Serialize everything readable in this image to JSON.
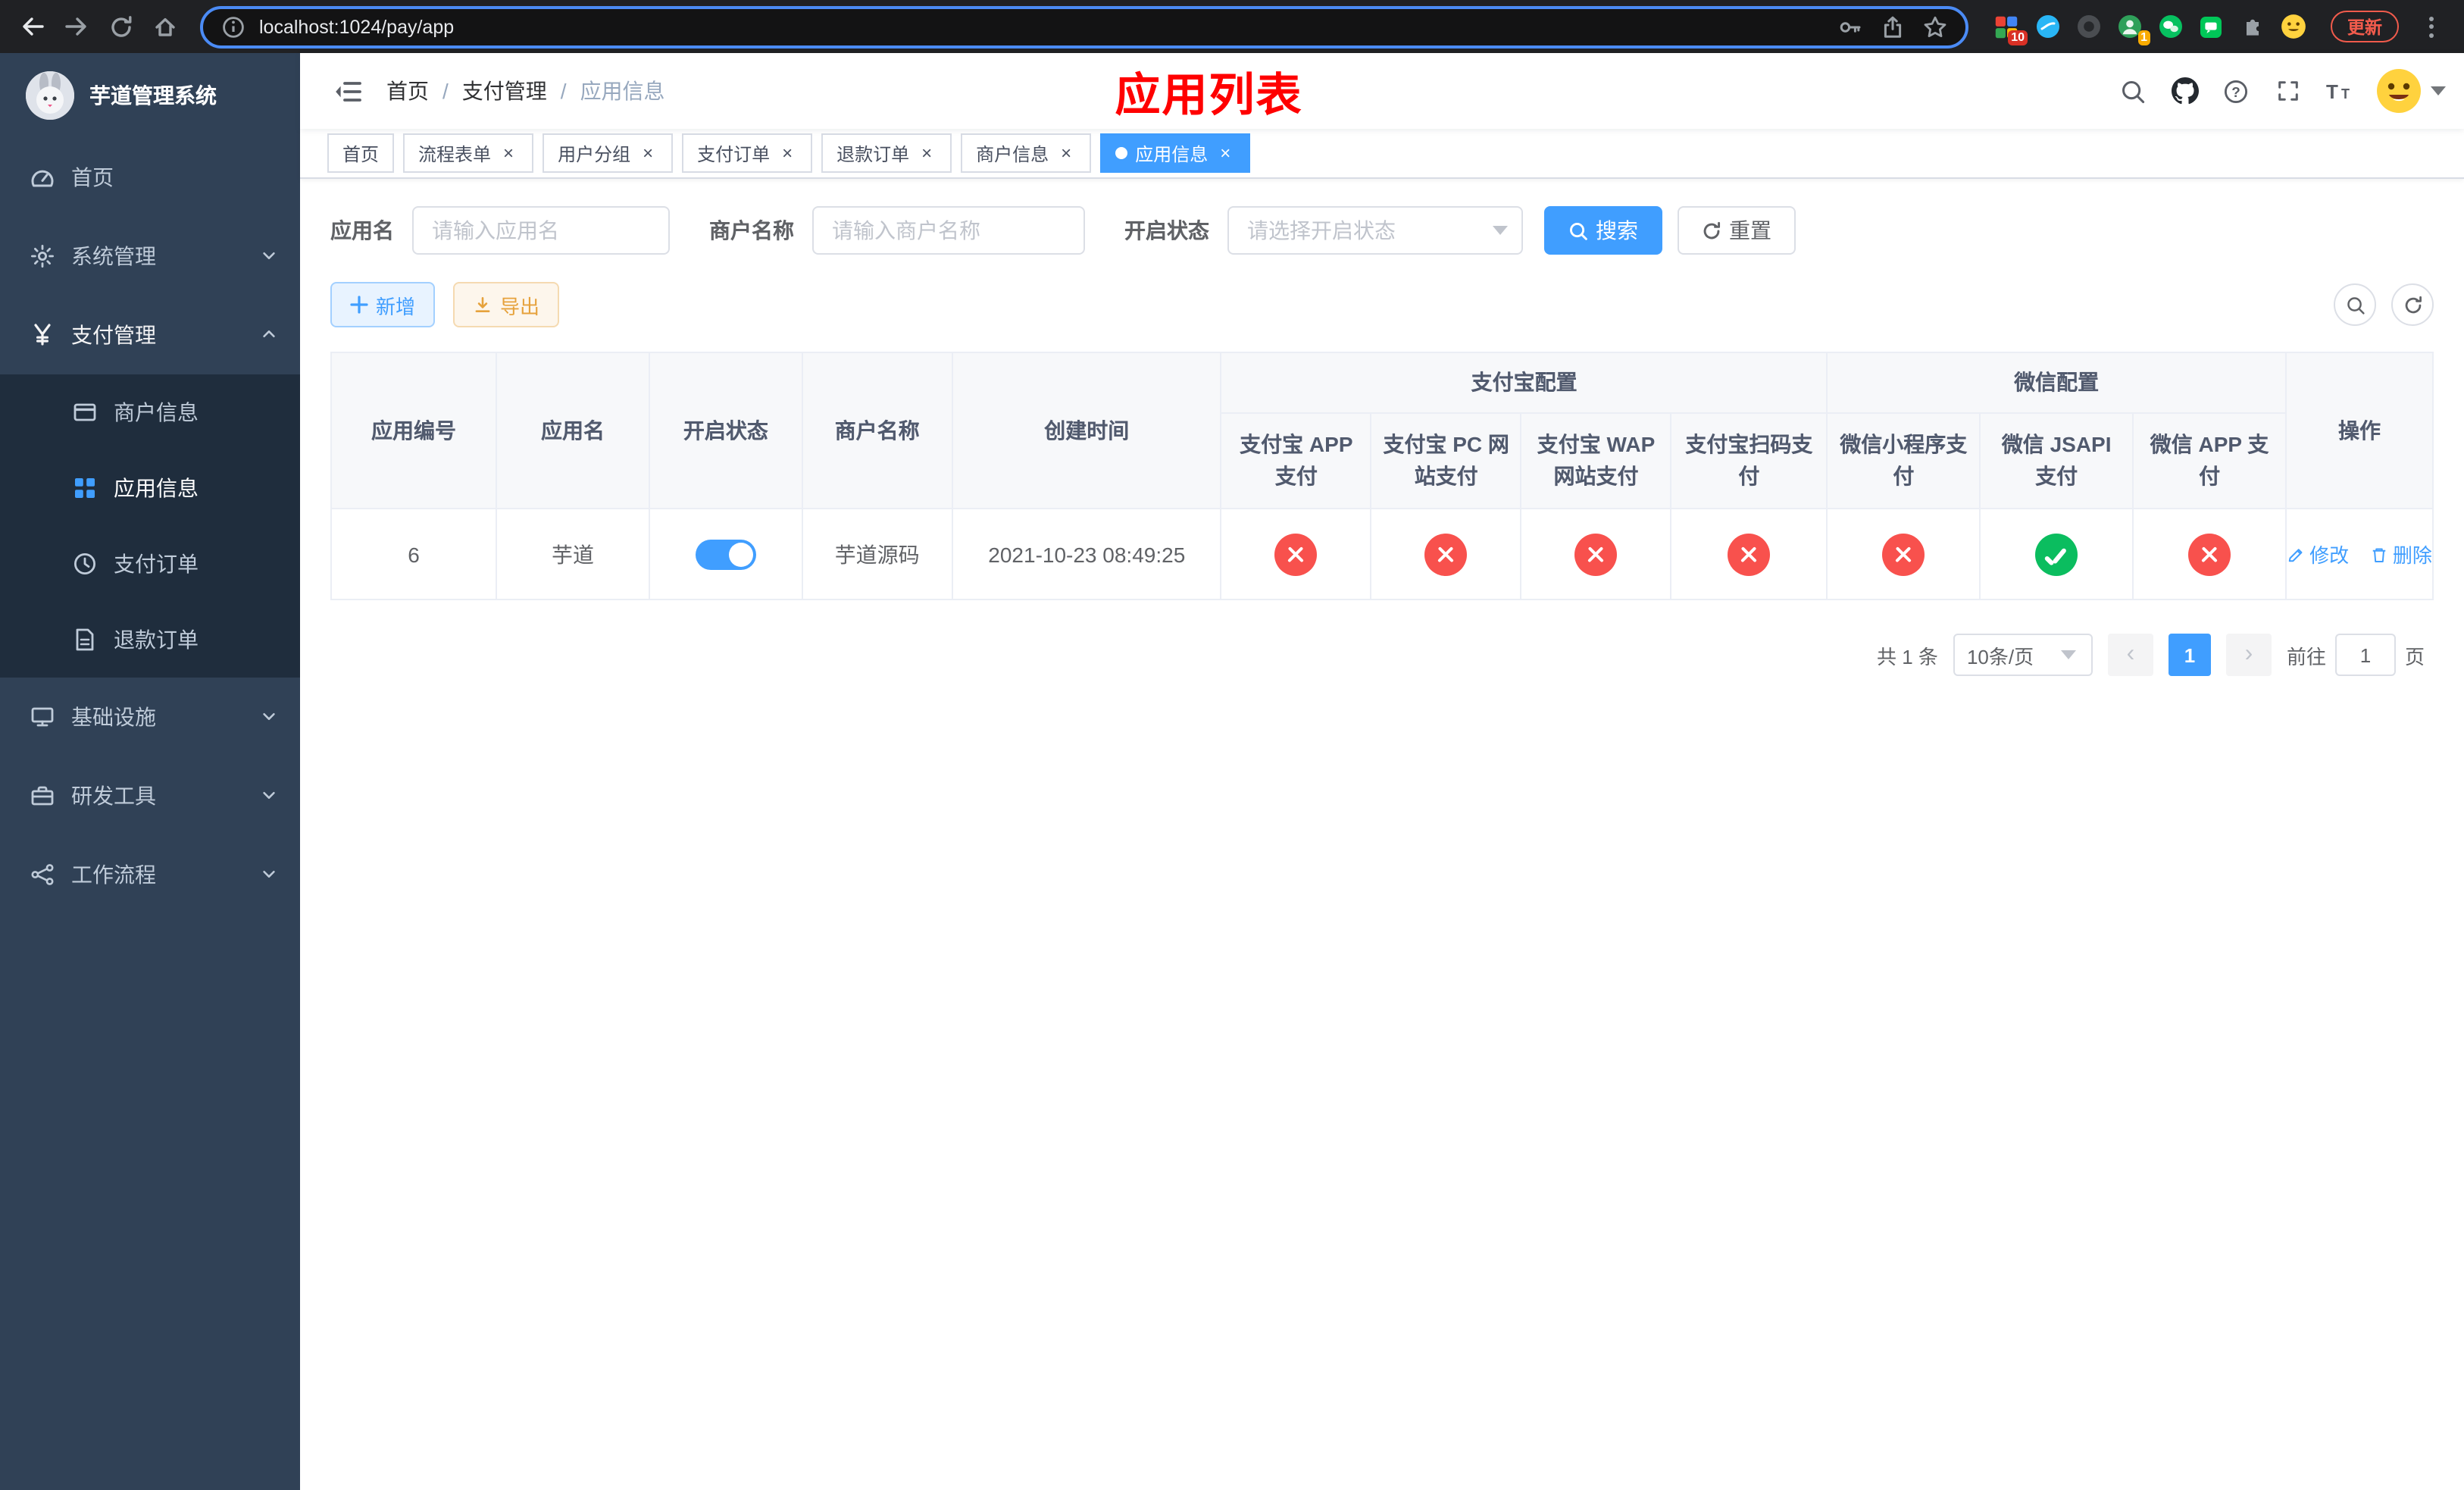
{
  "glyphs": {
    "breadcrumb_separator": "/",
    "tab_close": "×",
    "prev_arrow": "‹",
    "next_arrow": "›"
  },
  "browser": {
    "url": "localhost:1024/pay/app",
    "update_button": "更新",
    "extension_badge_ten": "10",
    "extension_badge_one": "1"
  },
  "sidebar": {
    "title": "芋道管理系统",
    "items": [
      {
        "label": "首页"
      },
      {
        "label": "系统管理"
      },
      {
        "label": "支付管理"
      },
      {
        "label": "基础设施"
      },
      {
        "label": "研发工具"
      },
      {
        "label": "工作流程"
      }
    ],
    "payment_children": [
      {
        "label": "商户信息"
      },
      {
        "label": "应用信息"
      },
      {
        "label": "支付订单"
      },
      {
        "label": "退款订单"
      }
    ]
  },
  "navbar": {
    "breadcrumb": [
      "首页",
      "支付管理",
      "应用信息"
    ],
    "annotation_title": "应用列表"
  },
  "tabs": [
    {
      "label": "首页"
    },
    {
      "label": "流程表单"
    },
    {
      "label": "用户分组"
    },
    {
      "label": "支付订单"
    },
    {
      "label": "退款订单"
    },
    {
      "label": "商户信息"
    },
    {
      "label": "应用信息"
    }
  ],
  "filters": {
    "app_name": {
      "label": "应用名",
      "placeholder": "请输入应用名",
      "value": ""
    },
    "merchant_name": {
      "label": "商户名称",
      "placeholder": "请输入商户名称",
      "value": ""
    },
    "status": {
      "label": "开启状态",
      "placeholder": "请选择开启状态"
    },
    "search_button": "搜索",
    "reset_button": "重置"
  },
  "toolbar": {
    "add_button": "新增",
    "export_button": "导出"
  },
  "table": {
    "columns": {
      "app_id": "应用编号",
      "app_name": "应用名",
      "status": "开启状态",
      "merchant_name": "商户名称",
      "created_at": "创建时间",
      "alipay_group": "支付宝配置",
      "wechat_group": "微信配置",
      "alipay": [
        "支付宝 APP 支付",
        "支付宝 PC 网站支付",
        "支付宝 WAP 网站支付",
        "支付宝扫码支付"
      ],
      "wechat": [
        "微信小程序支付",
        "微信 JSAPI 支付",
        "微信 APP 支付"
      ],
      "actions": "操作"
    },
    "rows": [
      {
        "app_id": "6",
        "app_name": "芋道",
        "status": "on",
        "merchant_name": "芋道源码",
        "created_at": "2021-10-23 08:49:25",
        "channels": [
          "disabled",
          "disabled",
          "disabled",
          "disabled",
          "disabled",
          "enabled",
          "disabled"
        ],
        "edit_label": "修改",
        "delete_label": "删除"
      }
    ]
  },
  "pagination": {
    "total": "共 1 条",
    "page_size": "10条/页",
    "page": "1",
    "goto_label": "前往",
    "goto_value": "1",
    "goto_unit": "页"
  },
  "colors": {
    "primary": "#409eff",
    "success": "#0bbd5f",
    "danger": "#f8514d",
    "warning": "#e6a23c",
    "sidebar_bg": "#304156",
    "submenu_bg": "#1f2d3d",
    "annotation": "#ff0000"
  }
}
